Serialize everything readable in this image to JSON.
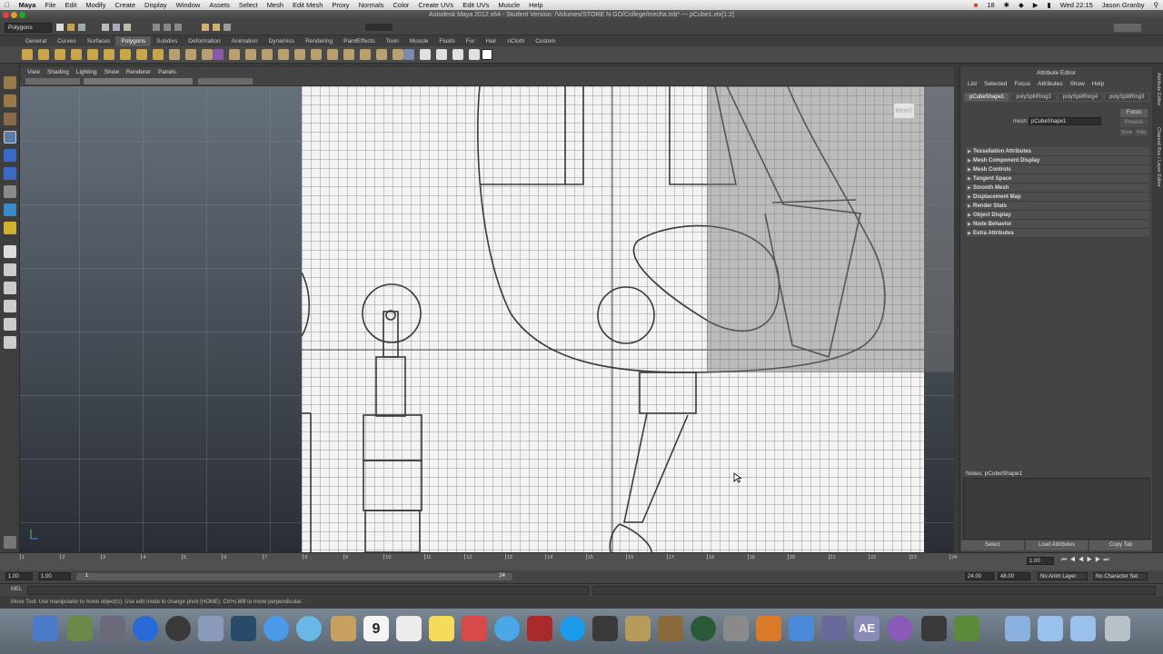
{
  "mac_menubar": {
    "app_name": "Maya",
    "items": [
      "File",
      "Edit",
      "Modify",
      "Create",
      "Display",
      "Window",
      "Assets",
      "Select",
      "Mesh",
      "Edit Mesh",
      "Proxy",
      "Normals",
      "Color",
      "Create UVs",
      "Edit UVs",
      "Muscle",
      "Help"
    ],
    "status_number": "18",
    "clock": "Wed 22:15",
    "user": "Jason Granby"
  },
  "window_title": "Autodesk Maya 2012 x64 - Student Version: /Volumes/STORE N GO/College/mecha.mb*  ---  pCube1.vtx[1:2]",
  "status_line": {
    "menu_set": "Polygons"
  },
  "shelf_tabs": [
    "General",
    "Curves",
    "Surfaces",
    "Polygons",
    "Subdivs",
    "Deformation",
    "Animation",
    "Dynamics",
    "Rendering",
    "PaintEffects",
    "Toon",
    "Muscle",
    "Fluids",
    "Fur",
    "Hair",
    "nCloth",
    "Custom"
  ],
  "shelf_active_tab": "Polygons",
  "panel_menu": [
    "View",
    "Shading",
    "Lighting",
    "Show",
    "Renderer",
    "Panels"
  ],
  "viewport": {
    "view_label": "RIGHT"
  },
  "attribute_editor": {
    "title": "Attribute Editor",
    "menu": [
      "List",
      "Selected",
      "Focus",
      "Attributes",
      "Show",
      "Help"
    ],
    "tabs": [
      "pCubeShape1",
      "polySplitRing3",
      "polySplitRing4",
      "polySplitRing3"
    ],
    "mesh_label": "mesh:",
    "mesh_value": "pCubeShape1",
    "focus_button": "Focus",
    "presets_button": "Presets",
    "show_button": "Show",
    "hide_button": "Hide",
    "sections": [
      "Tessellation Attributes",
      "Mesh Component Display",
      "Mesh Controls",
      "Tangent Space",
      "Smooth Mesh",
      "Displacement Map",
      "Render Stats",
      "Object Display",
      "Node Behavior",
      "Extra Attributes"
    ],
    "notes_label": "Notes:  pCubeShape1",
    "buttons": [
      "Select",
      "Load Attributes",
      "Copy Tab"
    ]
  },
  "side_tabs": [
    "Attribute Editor",
    "Channel Box / Layer Editor"
  ],
  "time_slider": {
    "ticks": [
      "1",
      "2",
      "3",
      "4",
      "5",
      "6",
      "7",
      "8",
      "9",
      "10",
      "11",
      "12",
      "13",
      "14",
      "15",
      "16",
      "17",
      "18",
      "19",
      "20",
      "21",
      "22",
      "23",
      "24"
    ],
    "current_frame": "1.00"
  },
  "range_slider": {
    "start_time": "1.00",
    "playback_start": "1.00",
    "range_start": "1",
    "range_end": "24",
    "playback_end": "24.00",
    "end_time": "48.00",
    "anim_layer": "No Anim Layer",
    "character_set": "No Character Set"
  },
  "command_line": {
    "label": "MEL"
  },
  "help_line": "Move Tool: Use manipulator to move object(s). Use edit mode to change pivot (HOME). Ctrl+LMB to move perpendicular.",
  "dock": {
    "calendar_day": "9",
    "app_label_ae": "AE"
  }
}
